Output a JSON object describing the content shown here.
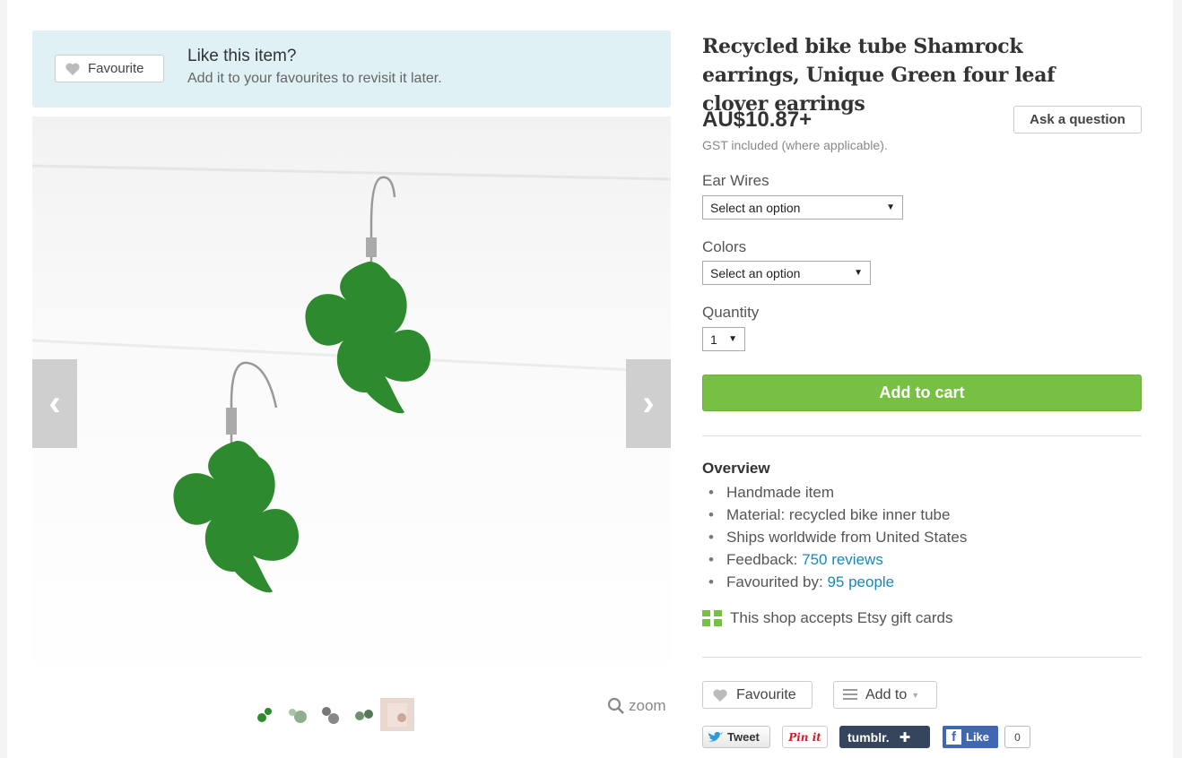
{
  "banner": {
    "favourite_label": "Favourite",
    "title": "Like this item?",
    "subtitle": "Add it to your favourites to revisit it later."
  },
  "gallery": {
    "prev_glyph": "‹",
    "next_glyph": "›",
    "thumbnail_count": 5,
    "zoom_label": "zoom"
  },
  "product": {
    "title": "Recycled bike tube Shamrock earrings, Unique Green four leaf clover earrings",
    "price": "AU$10.87+",
    "gst_note": "GST included (where applicable).",
    "ask_button": "Ask a question"
  },
  "options": {
    "ear_wires_label": "Ear Wires",
    "ear_wires_value": "Select an option",
    "colors_label": "Colors",
    "colors_value": "Select an option",
    "quantity_label": "Quantity",
    "quantity_value": "1"
  },
  "cart": {
    "add_to_cart": "Add to cart"
  },
  "overview": {
    "title": "Overview",
    "handmade": "Handmade item",
    "material": "Material: recycled bike inner tube",
    "ships": "Ships worldwide from United States",
    "feedback_label": "Feedback: ",
    "feedback_link": "750 reviews",
    "favourited_label": "Favourited by: ",
    "favourited_link": "95 people"
  },
  "gift_cards": "This shop accepts Etsy gift cards",
  "actions": {
    "favourite": "Favourite",
    "add_to": "Add to"
  },
  "social": {
    "tweet": "Tweet",
    "pinit": "Pin it",
    "tumblr": "tumblr.",
    "fb_like": "Like",
    "fb_count": "0"
  },
  "colors": {
    "banner_bg": "#dff1f5",
    "cart_green": "#77c044",
    "link_blue": "#1b87b3",
    "clover_green": "#2e8a2e"
  }
}
